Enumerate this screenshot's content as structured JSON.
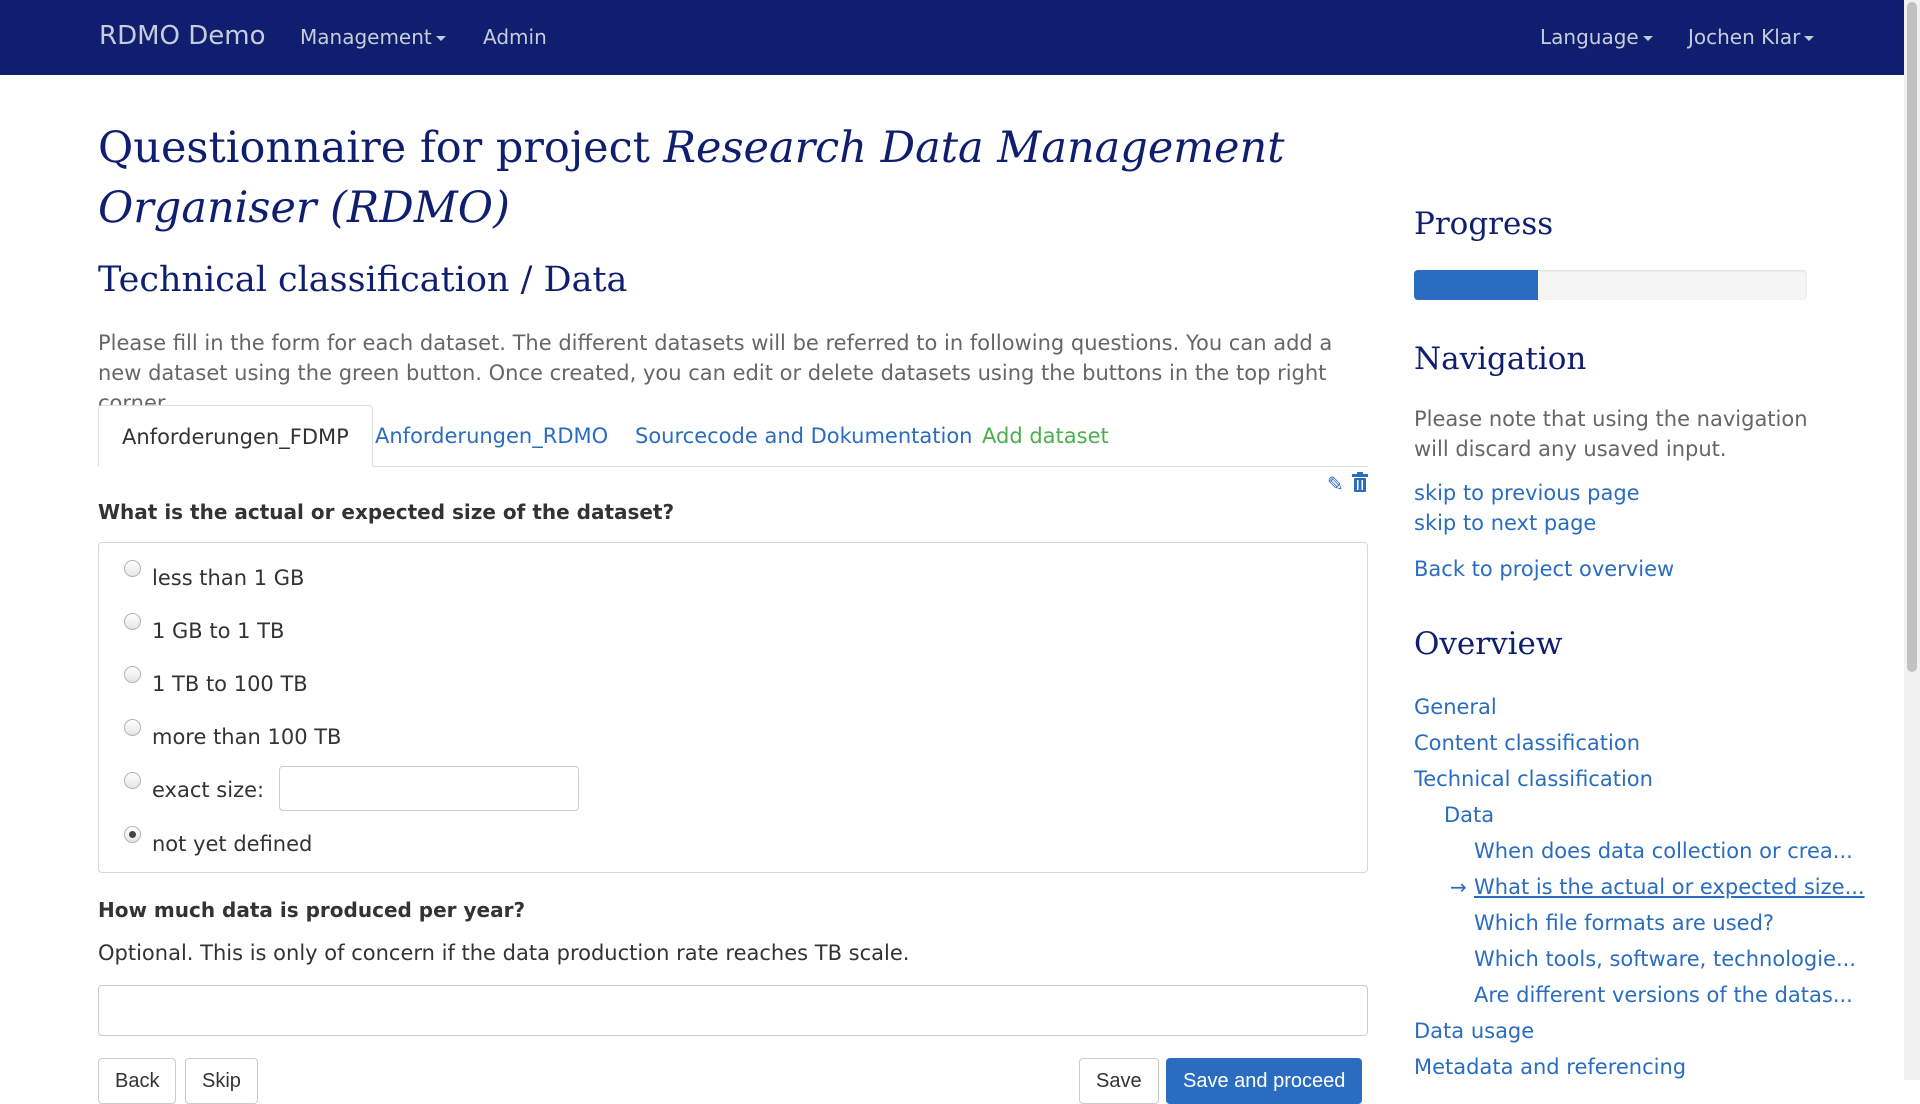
{
  "navbar": {
    "brand": "RDMO Demo",
    "management": "Management",
    "admin": "Admin",
    "language": "Language",
    "user": "Jochen Klar"
  },
  "page": {
    "title_prefix": "Questionnaire for project",
    "title_project": "Research Data Management Organiser (RDMO)",
    "section_title": "Technical classification / Data",
    "help": "Please fill in the form for each dataset. The different datasets will be referred to in following questions. You can add a new dataset using the green button. Once created, you can edit or delete datasets using the buttons in the top right corner."
  },
  "tabs": [
    {
      "label": "Anforderungen_FDMP",
      "active": true
    },
    {
      "label": "Anforderungen_RDMO"
    },
    {
      "label": "Sourcecode and Dokumentation"
    },
    {
      "label": "Add dataset"
    }
  ],
  "icons": {
    "edit": "pencil-icon",
    "delete": "trash-icon"
  },
  "question1": {
    "label": "What is the actual or expected size of the dataset?",
    "options": [
      {
        "label": "less than 1 GB",
        "checked": false
      },
      {
        "label": "1 GB to 1 TB",
        "checked": false
      },
      {
        "label": "1 TB to 100 TB",
        "checked": false
      },
      {
        "label": "more than 100 TB",
        "checked": false
      },
      {
        "label": "exact size:",
        "checked": false
      },
      {
        "label": "not yet defined",
        "checked": true
      }
    ],
    "exact_value": ""
  },
  "question2": {
    "label": "How much data is produced per year?",
    "help": "Optional. This is only of concern if the data production rate reaches TB scale.",
    "value": ""
  },
  "buttons": {
    "back": "Back",
    "skip": "Skip",
    "save": "Save",
    "save_proceed": "Save and proceed"
  },
  "sidebar": {
    "progress_title": "Progress",
    "progress_fraction": 0.315,
    "navigation_title": "Navigation",
    "navigation_note": "Please note that using the navigation will discard any usaved input.",
    "skip_prev": "skip to previous page",
    "skip_next": "skip to next page",
    "back_overview": "Back to project overview",
    "overview_title": "Overview",
    "overview": [
      "General",
      "Content classification",
      "Technical classification",
      "Data",
      "When does data collection or crea...",
      "What is the actual or expected size...",
      "Which file formats are used?",
      "Which tools, software, technologie...",
      "Are different versions of the datas...",
      "Data usage",
      "Metadata and referencing"
    ],
    "current_arrow": "→"
  },
  "colors": {
    "navbar": "#0f1e6e",
    "link": "#2a6dc0",
    "add_dataset": "#4cae4c"
  }
}
